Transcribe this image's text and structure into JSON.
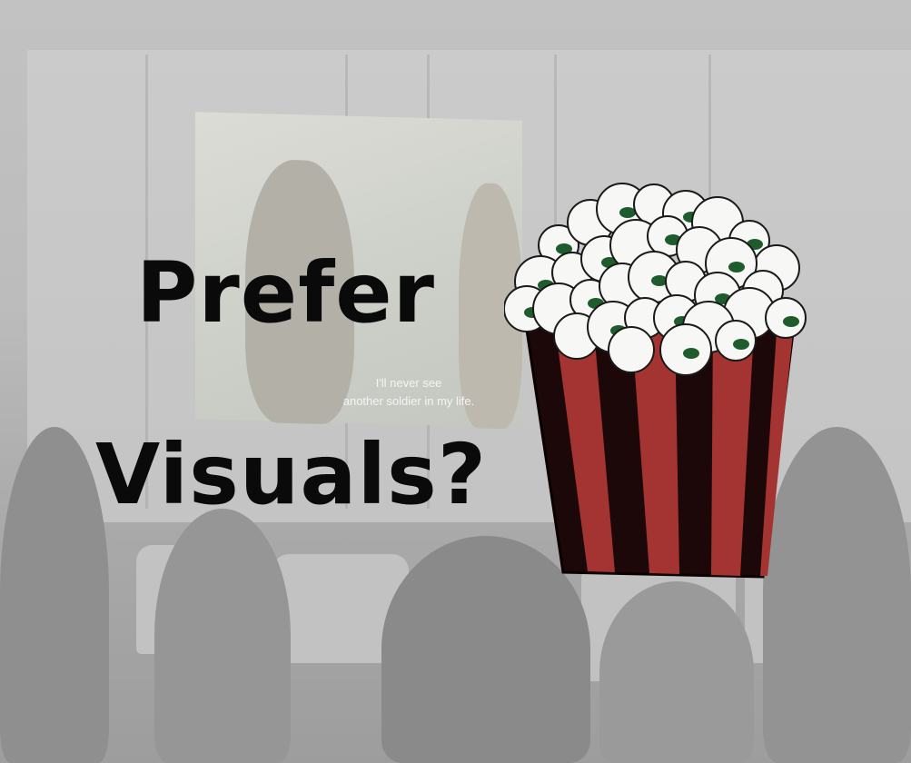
{
  "headline": {
    "line1": "Prefer",
    "line2": "Visuals?"
  },
  "background_photo": {
    "subtitle_line1": "I'll never see",
    "subtitle_line2": "another soldier in my life."
  },
  "icons": {
    "popcorn": "popcorn-bucket-icon"
  },
  "colors": {
    "background": "#bdbdbd",
    "text": "#0a0a0a",
    "stripe_red": "#a33431",
    "stripe_dark": "#1c0808",
    "popcorn_white": "#f7f7f5",
    "popcorn_green": "#1e5c2e"
  }
}
